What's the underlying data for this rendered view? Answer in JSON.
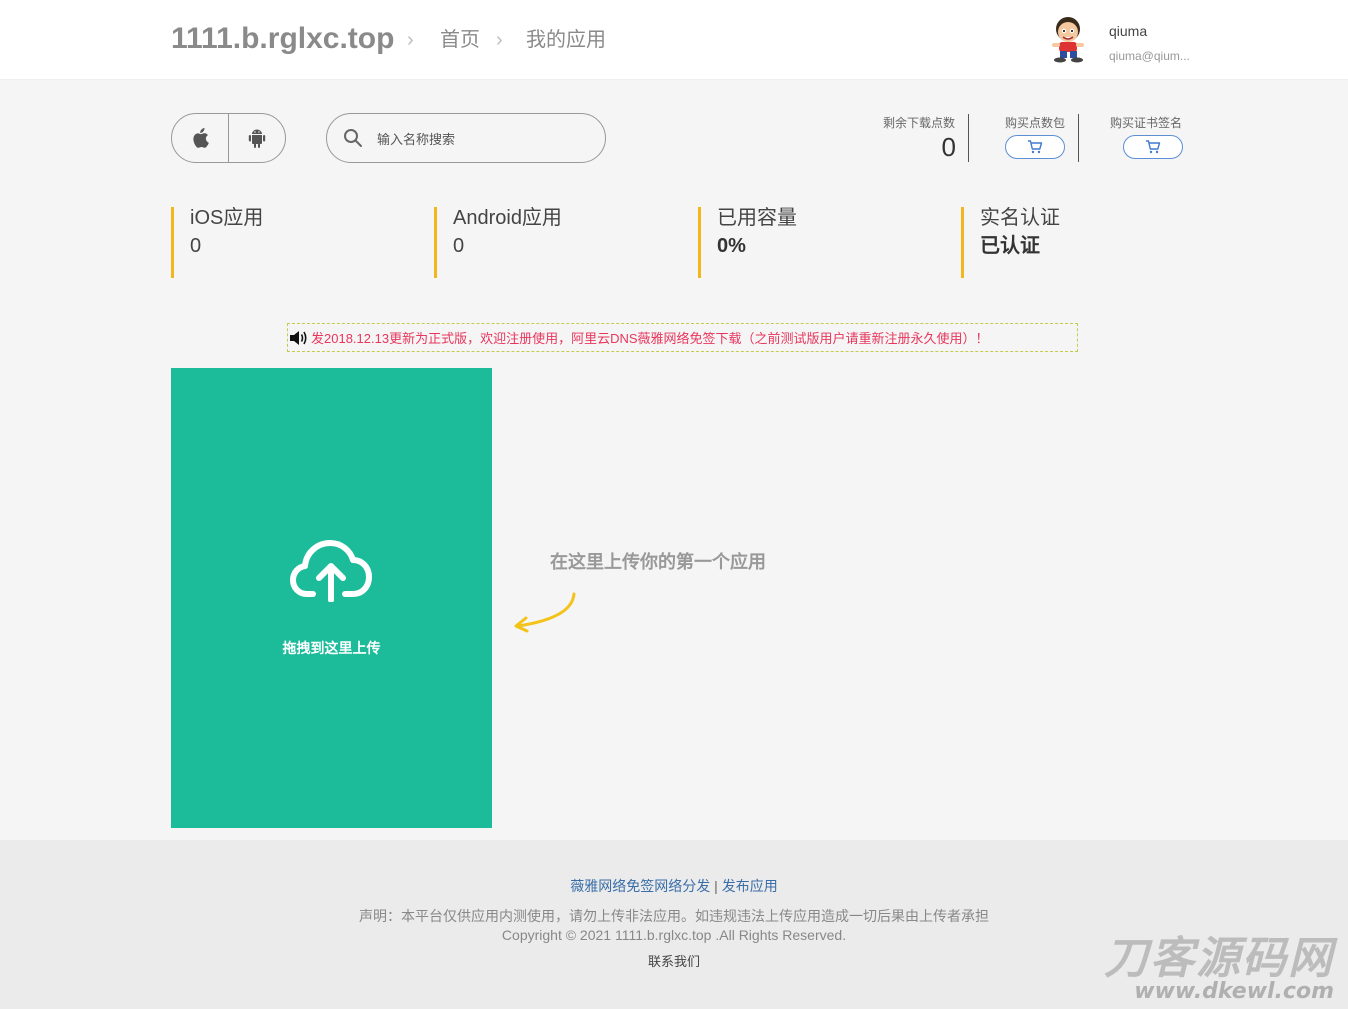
{
  "header": {
    "site_title": "1111.b.rglxc.top",
    "breadcrumb": [
      "首页",
      "我的应用"
    ],
    "user": {
      "name": "qiuma",
      "email": "qiuma@qium..."
    }
  },
  "toolbar": {
    "platform_filters": [
      {
        "name": "ios",
        "icon": "apple-icon"
      },
      {
        "name": "android",
        "icon": "android-icon"
      }
    ],
    "search": {
      "placeholder": "输入名称搜索",
      "value": ""
    }
  },
  "account": {
    "remaining_downloads": {
      "label": "剩余下载点数",
      "value": "0"
    },
    "buy_points": {
      "label": "购买点数包",
      "icon": "cart-icon"
    },
    "buy_cert": {
      "label": "购买证书签名",
      "icon": "cart-icon"
    }
  },
  "stats": [
    {
      "label": "iOS应用",
      "value": "0"
    },
    {
      "label": "Android应用",
      "value": "0"
    },
    {
      "label": "已用容量",
      "value": "0%"
    },
    {
      "label": "实名认证",
      "value": "已认证"
    }
  ],
  "notice": {
    "icon": "speaker-icon",
    "text": "发2018.12.13更新为正式版，欢迎注册使用，阿里云DNS薇雅网络免签下载（之前测试版用户请重新注册永久使用）！"
  },
  "upload": {
    "label": "拖拽到这里上传",
    "hint": "在这里上传你的第一个应用"
  },
  "footer": {
    "links": [
      "薇雅网络免签网络分发",
      "发布应用"
    ],
    "separator": "|",
    "disclaimer": "声明：本平台仅供应用内测使用，请勿上传非法应用。如违规违法上传应用造成一切后果由上传者承担",
    "copyright": "Copyright © 2021 1111.b.rglxc.top .All Rights Reserved.",
    "contact": "联系我们"
  },
  "watermark": {
    "text": "刀客源码网",
    "url": "www.dkewl.com"
  },
  "colors": {
    "accent_green": "#1cbc9b",
    "stat_border": "#f3b61f",
    "notice_text": "#e8365d",
    "link_blue": "#3a6ea8"
  }
}
